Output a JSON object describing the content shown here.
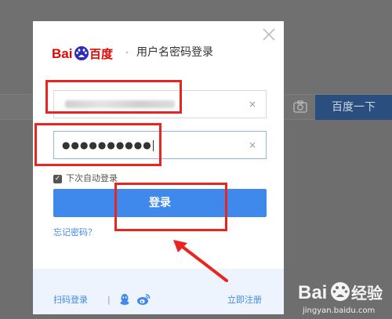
{
  "background": {
    "search_button_label": "百度一下",
    "camera_icon": "camera-icon"
  },
  "dialog": {
    "close_icon": "close-icon",
    "logo_text": "Bai百度",
    "title_separator": "·",
    "title": "用户名密码登录",
    "username": {
      "value": "",
      "clear_icon": "close-icon",
      "clear_glyph": "×"
    },
    "password": {
      "value": "●●●●●●●●●●",
      "clear_icon": "close-icon",
      "clear_glyph": "×"
    },
    "remember_checkbox_checked": true,
    "checkbox_glyph": "✓",
    "remember_label": "下次自动登录",
    "login_button_label": "登录",
    "forgot_link": "忘记密码？",
    "footer": {
      "scan_login": "扫码登录",
      "separator": "|",
      "qq_icon": "qq-icon",
      "weibo_icon": "weibo-icon",
      "register_link": "立即注册"
    }
  },
  "watermark": {
    "logo_text": "Bai经验",
    "url": "jingyan.baidu.com"
  },
  "colors": {
    "accent": "#3f89ec",
    "annotation": "#e8261f",
    "overlay": "#6e6e6e"
  }
}
